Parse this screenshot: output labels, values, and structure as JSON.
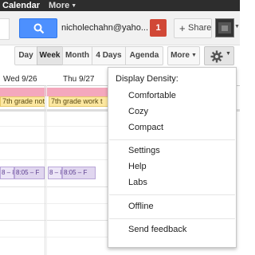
{
  "topbar": {
    "app_name": "Calendar",
    "more_label": "More"
  },
  "header": {
    "user_email": "nicholechahn@yaho...",
    "notification_count": "1",
    "share_label": "Share"
  },
  "toolbar": {
    "views": [
      "Day",
      "Week",
      "Month",
      "4 Days",
      "Agenda"
    ],
    "selected_view": "Week",
    "more_label": "More"
  },
  "calendar": {
    "day_headers": [
      "Wed 9/26",
      "Thu 9/27"
    ],
    "allday_events": [
      "7th grade notes",
      "7th grade work t"
    ],
    "timed_events": [
      {
        "label": "8 – 8:35"
      },
      {
        "label": "8:05 – F"
      },
      {
        "label": "8 – 8:35 Choose"
      },
      {
        "label": "8:05 – F"
      }
    ]
  },
  "settings_menu": {
    "heading": "Display Density:",
    "density_options": [
      "Comfortable",
      "Cozy",
      "Compact"
    ],
    "items": [
      "Settings",
      "Help",
      "Labs"
    ],
    "offline": "Offline",
    "feedback": "Send feedback"
  },
  "colors": {
    "accent_blue": "#4d90fe",
    "notification_red": "#d14836",
    "allday_event": "#fde8a1",
    "event_purple": "#e0d6ef",
    "pink_band": "#f4a8bd"
  }
}
